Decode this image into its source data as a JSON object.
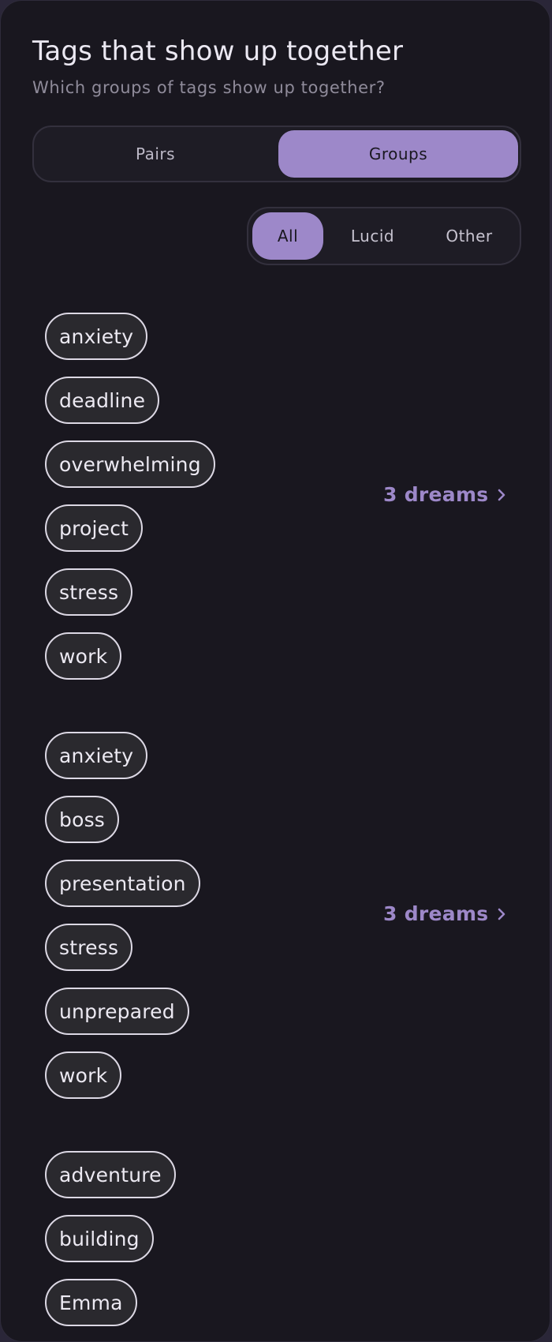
{
  "header": {
    "title": "Tags that show up together",
    "subtitle": "Which groups of tags show up together?"
  },
  "mode_toggle": {
    "pairs_label": "Pairs",
    "groups_label": "Groups",
    "selected": "Groups"
  },
  "filter": {
    "all_label": "All",
    "lucid_label": "Lucid",
    "other_label": "Other",
    "selected": "All"
  },
  "colors": {
    "accent": "#9d88c9",
    "background": "#19171f",
    "tag_border": "#dcd8e4"
  },
  "groups": [
    {
      "tags": [
        "anxiety",
        "deadline",
        "overwhelming",
        "project",
        "stress",
        "work"
      ],
      "count_label": "3 dreams"
    },
    {
      "tags": [
        "anxiety",
        "boss",
        "presentation",
        "stress",
        "unprepared",
        "work"
      ],
      "count_label": "3 dreams"
    },
    {
      "tags": [
        "adventure",
        "building",
        "Emma"
      ],
      "count_label": ""
    }
  ]
}
